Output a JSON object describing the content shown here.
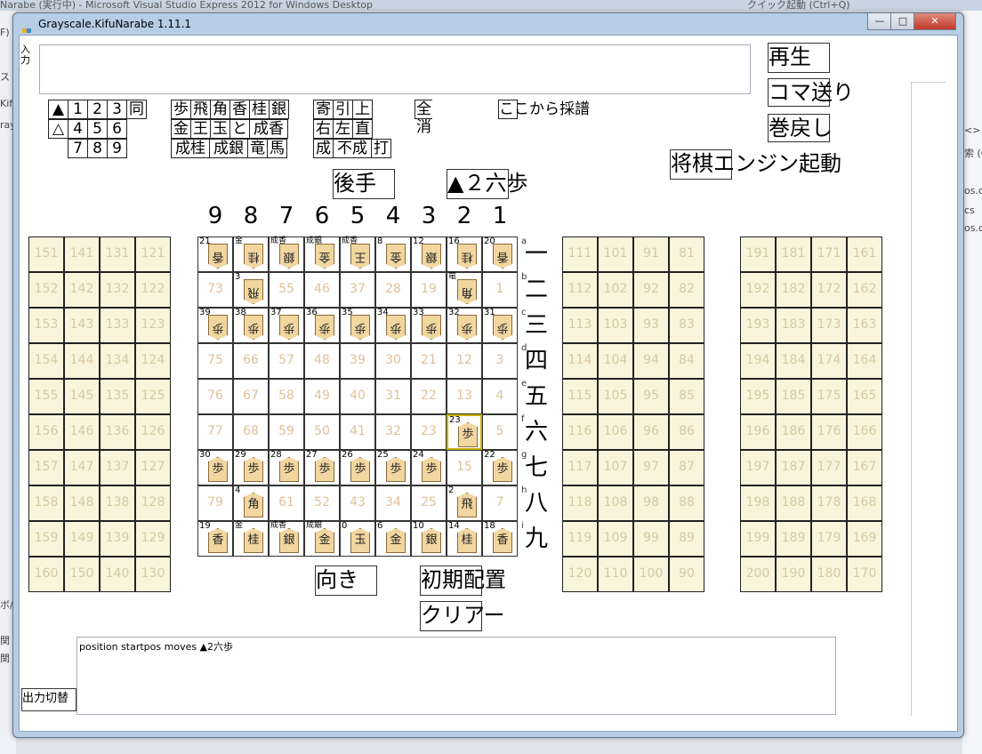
{
  "ide": {
    "title": "Narabe (実行中) - Microsoft Visual Studio Express 2012 for Windows Desktop",
    "quick_launch": "クイック起動 (Ctrl+Q)",
    "left_fragments": [
      "F)",
      "ス",
      "Kif",
      "ray",
      "ボ/",
      "関 C",
      "関 C"
    ],
    "right_fragments": [
      "<>",
      "索 (Ct",
      "os.cs",
      "cs",
      "os.c"
    ]
  },
  "window": {
    "title": "Grayscale.KifuNarabe 1.11.1",
    "min_glyph": "—",
    "max_glyph": "□",
    "close_glyph": "✕"
  },
  "input": {
    "label": "入力",
    "value": ""
  },
  "right_buttons": {
    "play": "再生",
    "step": "コマ送り",
    "rewind": "巻戻し",
    "engine": "将棋エンジン起動"
  },
  "player_turn": "後手",
  "move_display": "▲２六歩",
  "bottom_buttons": {
    "direction": "向き",
    "initial": "初期配置",
    "clear": "クリアー",
    "output_toggle": "出力切替"
  },
  "output_text": "position startpos moves ▲2六歩",
  "keypad": {
    "rows": [
      [
        "▲",
        "1",
        "2",
        "3",
        "同"
      ],
      [
        "△",
        "4",
        "5",
        "6"
      ],
      [
        "",
        "7",
        "8",
        "9"
      ]
    ]
  },
  "piece_keys": {
    "rows": [
      [
        "歩",
        "飛",
        "角",
        "香",
        "桂",
        "銀"
      ],
      [
        "金",
        "王",
        "玉",
        "と",
        "成香"
      ],
      [
        "成桂",
        "成銀",
        "竜",
        "馬"
      ]
    ]
  },
  "modifier_keys": {
    "rows": [
      [
        "寄",
        "引",
        "上"
      ],
      [
        "右",
        "左",
        "直"
      ],
      [
        "成",
        "不成",
        "打"
      ]
    ]
  },
  "clear_all": "全消",
  "from_here": "ここから採譜",
  "files": [
    "9",
    "8",
    "7",
    "6",
    "5",
    "4",
    "3",
    "2",
    "1"
  ],
  "ranks": [
    "一",
    "二",
    "三",
    "四",
    "五",
    "六",
    "七",
    "八",
    "九"
  ],
  "rank_letters": [
    "a",
    "b",
    "c",
    "d",
    "e",
    "f",
    "g",
    "h",
    "i"
  ],
  "board": [
    [
      {
        "n": "21",
        "p": "香",
        "e": true
      },
      {
        "n": "",
        "p": "桂",
        "e": true,
        "t": "金"
      },
      {
        "n": "",
        "p": "銀",
        "e": true,
        "t": "成香"
      },
      {
        "n": "",
        "p": "金",
        "e": true,
        "t": "成銀"
      },
      {
        "n": "",
        "p": "王",
        "e": true,
        "t": "成香"
      },
      {
        "n": "8",
        "p": "金",
        "e": true
      },
      {
        "n": "12",
        "p": "銀",
        "e": true
      },
      {
        "n": "16",
        "p": "桂",
        "e": true
      },
      {
        "n": "20",
        "p": "香",
        "e": true
      }
    ],
    [
      {
        "n": "73"
      },
      {
        "n": "3",
        "p": "飛",
        "e": true
      },
      {
        "n": "55"
      },
      {
        "n": "46"
      },
      {
        "n": "37"
      },
      {
        "n": "28"
      },
      {
        "n": "19"
      },
      {
        "n": "",
        "p": "角",
        "e": true,
        "t": "竜"
      },
      {
        "n": "1"
      }
    ],
    [
      {
        "n": "39",
        "p": "歩",
        "e": true
      },
      {
        "n": "38",
        "p": "歩",
        "e": true
      },
      {
        "n": "37",
        "p": "歩",
        "e": true
      },
      {
        "n": "36",
        "p": "歩",
        "e": true
      },
      {
        "n": "35",
        "p": "歩",
        "e": true
      },
      {
        "n": "34",
        "p": "歩",
        "e": true
      },
      {
        "n": "33",
        "p": "歩",
        "e": true
      },
      {
        "n": "32",
        "p": "歩",
        "e": true
      },
      {
        "n": "31",
        "p": "歩",
        "e": true
      }
    ],
    [
      {
        "n": "75"
      },
      {
        "n": "66"
      },
      {
        "n": "57"
      },
      {
        "n": "48"
      },
      {
        "n": "39"
      },
      {
        "n": "30"
      },
      {
        "n": "21"
      },
      {
        "n": "12"
      },
      {
        "n": "3"
      }
    ],
    [
      {
        "n": "76"
      },
      {
        "n": "67"
      },
      {
        "n": "58"
      },
      {
        "n": "49"
      },
      {
        "n": "40"
      },
      {
        "n": "31"
      },
      {
        "n": "22"
      },
      {
        "n": "13"
      },
      {
        "n": "4"
      }
    ],
    [
      {
        "n": "77"
      },
      {
        "n": "68"
      },
      {
        "n": "59"
      },
      {
        "n": "50"
      },
      {
        "n": "41"
      },
      {
        "n": "32"
      },
      {
        "n": "23"
      },
      {
        "n": "23",
        "p": "歩",
        "hl": true
      },
      {
        "n": "5"
      }
    ],
    [
      {
        "n": "30",
        "p": "歩"
      },
      {
        "n": "29",
        "p": "歩"
      },
      {
        "n": "28",
        "p": "歩"
      },
      {
        "n": "27",
        "p": "歩"
      },
      {
        "n": "26",
        "p": "歩"
      },
      {
        "n": "25",
        "p": "歩"
      },
      {
        "n": "24",
        "p": "歩"
      },
      {
        "n": "15"
      },
      {
        "n": "22",
        "p": "歩"
      }
    ],
    [
      {
        "n": "79"
      },
      {
        "n": "4",
        "p": "角"
      },
      {
        "n": "61"
      },
      {
        "n": "52"
      },
      {
        "n": "43"
      },
      {
        "n": "34"
      },
      {
        "n": "25"
      },
      {
        "n": "2",
        "p": "飛"
      },
      {
        "n": "7"
      }
    ],
    [
      {
        "n": "19",
        "p": "香"
      },
      {
        "n": "",
        "p": "桂",
        "t": "金"
      },
      {
        "n": "",
        "p": "銀",
        "t": "成香"
      },
      {
        "n": "",
        "p": "金",
        "t": "成銀"
      },
      {
        "n": "0",
        "p": "玉"
      },
      {
        "n": "6",
        "p": "金"
      },
      {
        "n": "10",
        "p": "銀"
      },
      {
        "n": "14",
        "p": "桂"
      },
      {
        "n": "18",
        "p": "香"
      }
    ]
  ],
  "captured_left": [
    [
      "151",
      "141",
      "131",
      "121"
    ],
    [
      "152",
      "142",
      "132",
      "122"
    ],
    [
      "153",
      "143",
      "133",
      "123"
    ],
    [
      "154",
      "144",
      "134",
      "124"
    ],
    [
      "155",
      "145",
      "135",
      "125"
    ],
    [
      "156",
      "146",
      "136",
      "126"
    ],
    [
      "157",
      "147",
      "137",
      "127"
    ],
    [
      "158",
      "148",
      "138",
      "128"
    ],
    [
      "159",
      "149",
      "139",
      "129"
    ],
    [
      "160",
      "150",
      "140",
      "130"
    ]
  ],
  "captured_mid": [
    [
      "111",
      "101",
      "91",
      "81"
    ],
    [
      "112",
      "102",
      "92",
      "82"
    ],
    [
      "113",
      "103",
      "93",
      "83"
    ],
    [
      "114",
      "104",
      "94",
      "84"
    ],
    [
      "115",
      "105",
      "95",
      "85"
    ],
    [
      "116",
      "106",
      "96",
      "86"
    ],
    [
      "117",
      "107",
      "97",
      "87"
    ],
    [
      "118",
      "108",
      "98",
      "88"
    ],
    [
      "119",
      "109",
      "99",
      "89"
    ],
    [
      "120",
      "110",
      "100",
      "90"
    ]
  ],
  "captured_right": [
    [
      "191",
      "181",
      "171",
      "161"
    ],
    [
      "192",
      "182",
      "172",
      "162"
    ],
    [
      "193",
      "183",
      "173",
      "163"
    ],
    [
      "194",
      "184",
      "174",
      "164"
    ],
    [
      "195",
      "185",
      "175",
      "165"
    ],
    [
      "196",
      "186",
      "176",
      "166"
    ],
    [
      "197",
      "187",
      "177",
      "167"
    ],
    [
      "198",
      "188",
      "178",
      "168"
    ],
    [
      "199",
      "189",
      "179",
      "169"
    ],
    [
      "200",
      "190",
      "180",
      "170"
    ]
  ]
}
